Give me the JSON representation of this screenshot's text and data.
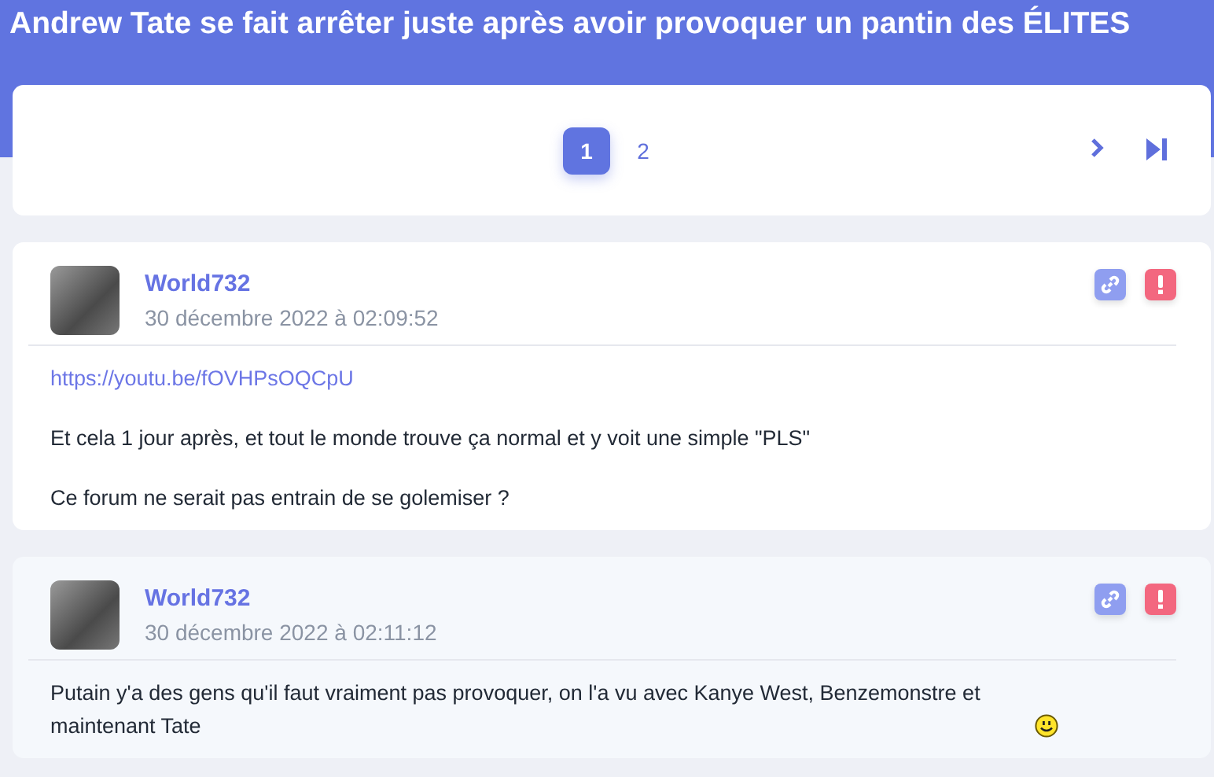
{
  "title": "Andrew Tate se fait arrêter juste après avoir provoquer un pantin des ÉLITES",
  "pagination": {
    "pages": [
      {
        "label": "1",
        "selected": true
      },
      {
        "label": "2",
        "selected": false
      }
    ]
  },
  "posts": [
    {
      "author": "World732",
      "date": "30 décembre 2022 à 02:09:52",
      "paragraphs": [
        {
          "kind": "link",
          "text": "https://youtu.be/fOVHPsOQCpU"
        },
        {
          "kind": "text",
          "text": "Et cela 1 jour après, et tout le monde trouve ça normal et y voit une simple \"PLS\""
        },
        {
          "kind": "text",
          "text": "Ce forum ne serait pas entrain de se golemiser ?"
        }
      ]
    },
    {
      "author": "World732",
      "date": "30 décembre 2022 à 02:11:12",
      "paragraphs": [
        {
          "kind": "text-smiley",
          "text": "Putain y'a des gens qu'il faut vraiment pas provoquer, on l'a vu avec Kanye West, Benzemonstre et maintenant Tate"
        }
      ]
    }
  ]
}
